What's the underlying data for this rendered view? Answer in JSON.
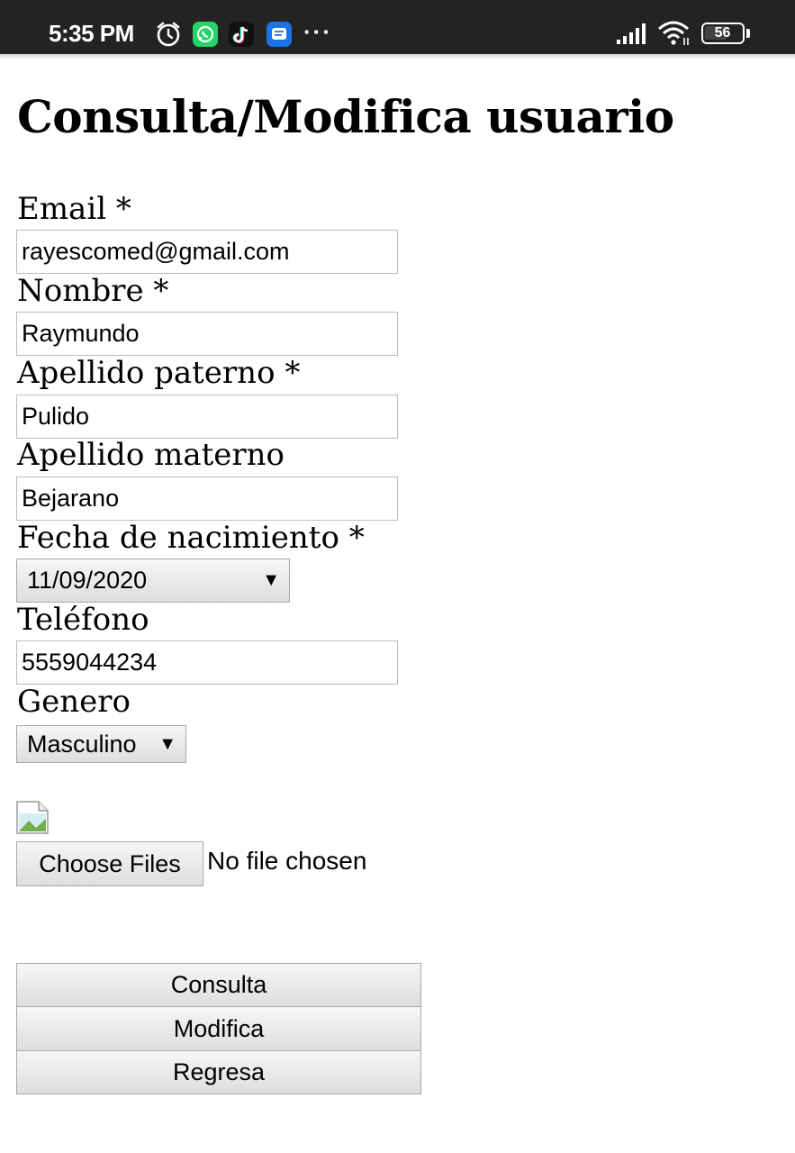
{
  "status_bar": {
    "time": "5:35 PM",
    "more": "···",
    "battery": "56",
    "icons": [
      "alarm-icon",
      "whatsapp-icon",
      "tiktok-icon",
      "messages-icon",
      "signal-icon",
      "wifi-icon",
      "battery-icon"
    ]
  },
  "page": {
    "title": "Consulta/Modifica usuario"
  },
  "form": {
    "email_label": "Email *",
    "email_value": "rayescomed@gmail.com",
    "nombre_label": "Nombre *",
    "nombre_value": "Raymundo",
    "ap_paterno_label": "Apellido paterno *",
    "ap_paterno_value": "Pulido",
    "ap_materno_label": "Apellido materno",
    "ap_materno_value": "Bejarano",
    "fecha_label": "Fecha de nacimiento *",
    "fecha_value": "11/09/2020",
    "telefono_label": "Teléfono",
    "telefono_value": "5559044234",
    "genero_label": "Genero",
    "genero_value": "Masculino",
    "choose_files_label": "Choose Files",
    "no_file_text": "No file chosen"
  },
  "buttons": {
    "consulta": "Consulta",
    "modifica": "Modifica",
    "regresa": "Regresa"
  },
  "colors": {
    "status_bar_bg": "#232323",
    "whatsapp": "#25d366",
    "messages": "#1a73e8"
  }
}
